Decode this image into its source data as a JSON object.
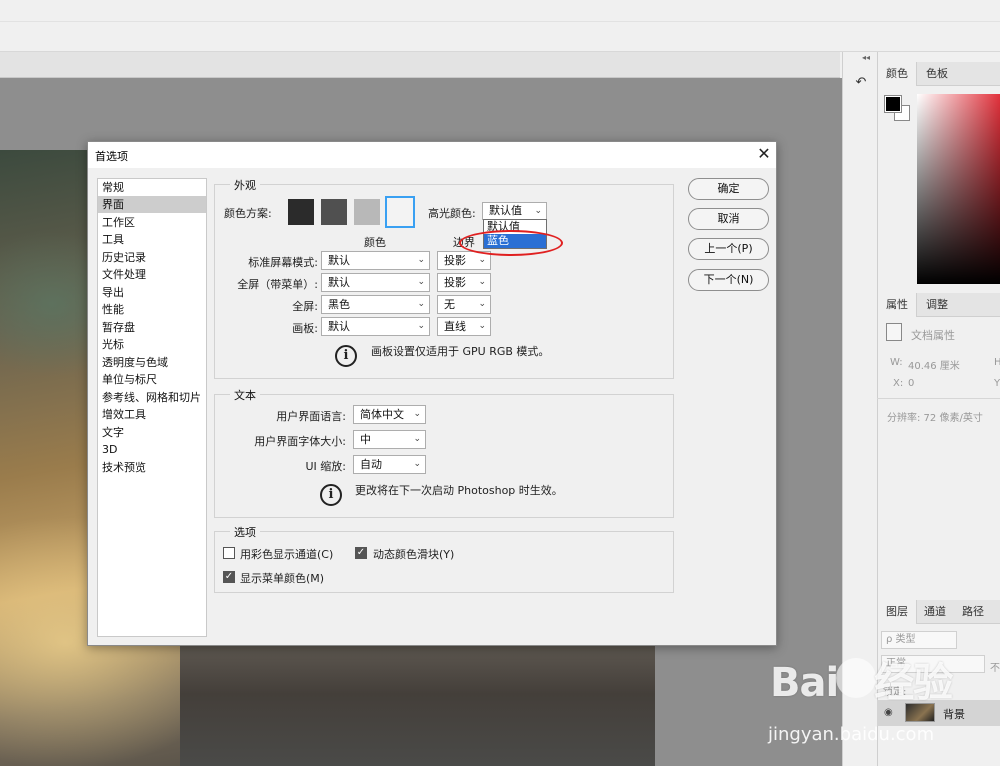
{
  "dialog": {
    "title": "首选项",
    "close_glyph": "✕",
    "nav_items": [
      "常规",
      "界面",
      "工作区",
      "工具",
      "历史记录",
      "文件处理",
      "导出",
      "性能",
      "暂存盘",
      "光标",
      "透明度与色域",
      "单位与标尺",
      "参考线、网格和切片",
      "增效工具",
      "文字",
      "3D",
      "技术预览"
    ],
    "selected_nav": "界面",
    "appearance": {
      "title": "外观",
      "color_theme_label": "颜色方案:",
      "theme_swatches": [
        "#2b2b2b",
        "#505050",
        "#b8b8b8",
        "#f0f0f0"
      ],
      "highlight_label": "高光颜色:",
      "highlight_value": "默认值",
      "highlight_options": [
        "默认值",
        "蓝色"
      ],
      "col_color_header": "颜色",
      "col_border_header": "边界",
      "rows": [
        {
          "label": "标准屏幕模式:",
          "color": "默认",
          "border": "投影"
        },
        {
          "label": "全屏（带菜单）:",
          "color": "默认",
          "border": "投影"
        },
        {
          "label": "全屏:",
          "color": "黑色",
          "border": "无"
        },
        {
          "label": "画板:",
          "color": "默认",
          "border": "直线"
        }
      ],
      "info_text": "画板设置仅适用于 GPU RGB 模式。"
    },
    "text_group": {
      "title": "文本",
      "ui_language_label": "用户界面语言:",
      "ui_language_value": "简体中文",
      "ui_font_size_label": "用户界面字体大小:",
      "ui_font_size_value": "中",
      "ui_scaling_label": "UI 缩放:",
      "ui_scaling_value": "自动",
      "info_text": "更改将在下一次启动 Photoshop 时生效。"
    },
    "options": {
      "title": "选项",
      "show_channels_color": {
        "label": "用彩色显示通道(C)",
        "checked": false
      },
      "dynamic_color_sliders": {
        "label": "动态颜色滑块(Y)",
        "checked": true
      },
      "show_menu_colors": {
        "label": "显示菜单颜色(M)",
        "checked": true
      }
    },
    "buttons": {
      "ok": "确定",
      "cancel": "取消",
      "prev": "上一个(P)",
      "next": "下一个(N)"
    }
  },
  "right_panel": {
    "collapse_glyph": "◂◂",
    "color_tabs": [
      "颜色",
      "色板"
    ],
    "props_tabs": [
      "属性",
      "调整"
    ],
    "doc_props_label": "文档属性",
    "width_label": "W:",
    "width_value": "40.46 厘米",
    "height_label": "H",
    "x_label": "X:",
    "x_value": "0",
    "y_label": "Y",
    "resolution": "分辨率: 72 像素/英寸",
    "layer_tabs": [
      "图层",
      "通道",
      "路径"
    ],
    "kind_filter": "ρ 类型",
    "blend_mode": "正常",
    "opacity_short": "不",
    "lock_label": "锁定:",
    "layer_name": "背景",
    "eye_glyph": "◉"
  },
  "watermark": {
    "logo": "Bai",
    "logo_suffix": "经验",
    "url": "jingyan.baidu.com"
  },
  "icons": {
    "history": "history-icon",
    "info": "info-icon",
    "chevron": "chevron-down-icon",
    "close": "close-icon"
  },
  "colors": {
    "accent_blue": "#2a6fd4",
    "selection_border": "#39a0f2",
    "annotation_red": "#e02020"
  }
}
